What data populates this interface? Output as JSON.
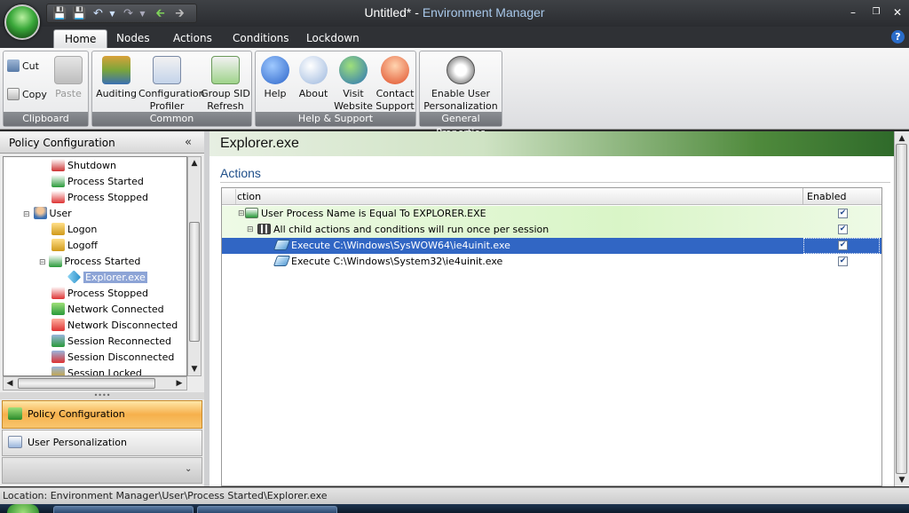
{
  "window": {
    "title_doc": "Untitled*",
    "title_sep": " - ",
    "title_app": "Environment Manager"
  },
  "tabs": [
    "Home",
    "Nodes",
    "Actions",
    "Conditions",
    "Lockdown"
  ],
  "ribbon": {
    "clipboard": {
      "label": "Clipboard",
      "cut": "Cut",
      "copy": "Copy",
      "paste": "Paste"
    },
    "common": {
      "label": "Common",
      "auditing": "Auditing",
      "config_profiler_1": "Configuration",
      "config_profiler_2": "Profiler",
      "group_sid_1": "Group SID",
      "group_sid_2": "Refresh"
    },
    "help_support": {
      "label": "Help & Support",
      "help": "Help",
      "about": "About",
      "visit_1": "Visit",
      "visit_2": "Website",
      "contact_1": "Contact",
      "contact_2": "Support"
    },
    "general": {
      "label": "General Properties",
      "enable_1": "Enable User",
      "enable_2": "Personalization"
    }
  },
  "left_pane": {
    "header": "Policy Configuration",
    "tree": [
      {
        "label": "Shutdown",
        "icon": "shutdown-icon"
      },
      {
        "label": "Process Started",
        "icon": "process-started-icon"
      },
      {
        "label": "Process Stopped",
        "icon": "process-stopped-icon"
      },
      {
        "label": "User",
        "icon": "user-icon"
      },
      {
        "label": "Logon",
        "icon": "logon-icon"
      },
      {
        "label": "Logoff",
        "icon": "logoff-icon"
      },
      {
        "label": "Process Started",
        "icon": "process-started-icon"
      },
      {
        "label": "Explorer.exe",
        "icon": "node-icon"
      },
      {
        "label": "Process Stopped",
        "icon": "process-stopped-icon"
      },
      {
        "label": "Network Connected",
        "icon": "network-connected-icon"
      },
      {
        "label": "Network Disconnected",
        "icon": "network-disconnected-icon"
      },
      {
        "label": "Session Reconnected",
        "icon": "session-reconnected-icon"
      },
      {
        "label": "Session Disconnected",
        "icon": "session-disconnected-icon"
      },
      {
        "label": "Session Locked",
        "icon": "session-locked-icon"
      }
    ],
    "nav": {
      "policy": "Policy Configuration",
      "user": "User Personalization"
    }
  },
  "right_pane": {
    "header": "Explorer.exe",
    "section": "Actions",
    "columns": {
      "action": "ction",
      "enabled": "Enabled"
    },
    "rows": [
      {
        "text": "User Process Name is Equal To EXPLORER.EXE",
        "enabled": true
      },
      {
        "text": "All child actions and conditions will run once per session",
        "enabled": true
      },
      {
        "text": "Execute C:\\Windows\\SysWOW64\\ie4uinit.exe",
        "enabled": true
      },
      {
        "text": "Execute C:\\Windows\\System32\\ie4uinit.exe",
        "enabled": true
      }
    ]
  },
  "status": "Location: Environment Manager\\User\\Process Started\\Explorer.exe",
  "colors": {
    "selection": "#3166c4",
    "tree_selection": "#8da4d6",
    "nav_active": "#f6b04c",
    "header_green": "#4f8a3c"
  }
}
